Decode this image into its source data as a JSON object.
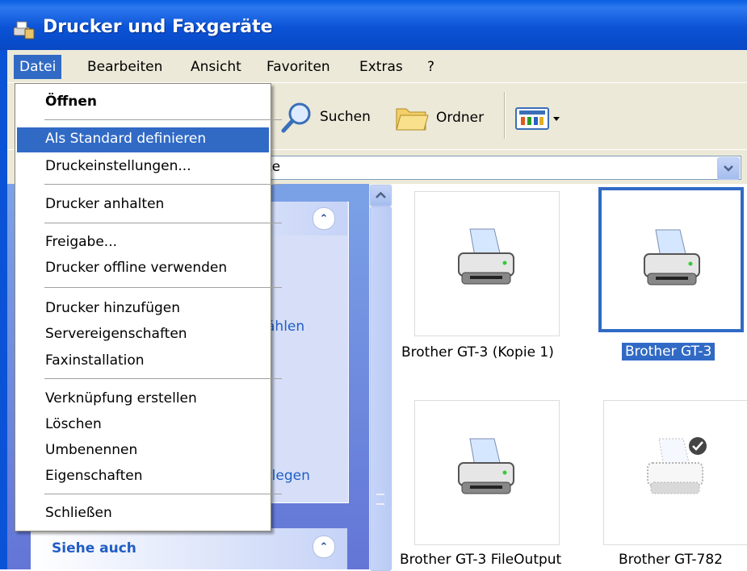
{
  "window": {
    "title": "Drucker und Faxgeräte"
  },
  "menubar": {
    "items": [
      "Datei",
      "Bearbeiten",
      "Ansicht",
      "Favoriten",
      "Extras",
      "?"
    ]
  },
  "toolbar": {
    "search_label": "Suchen",
    "folders_label": "Ordner"
  },
  "address": {
    "text_fragment": "te"
  },
  "dropdown": {
    "open": "Öffnen",
    "set_default": "Als Standard definieren",
    "print_prefs": "Druckeinstellungen...",
    "pause": "Drucker anhalten",
    "sharing": "Freigabe...",
    "offline": "Drucker offline verwenden",
    "add_printer": "Drucker hinzufügen",
    "server_props": "Servereigenschaften",
    "fax_setup": "Faxinstallation",
    "create_shortcut": "Verknüpfung erstellen",
    "delete": "Löschen",
    "rename": "Umbenennen",
    "properties": "Eigenschaften",
    "close": "Schließen"
  },
  "taskpane": {
    "partial_1": "ählen",
    "partial_2": "tlegen",
    "see_also": "Siehe auch"
  },
  "printers": [
    {
      "name": "Brother GT-3 (Kopie 1)"
    },
    {
      "name": "Brother GT-3",
      "selected": true
    },
    {
      "name": "Brother GT-3 FileOutput"
    },
    {
      "name": "Brother GT-782",
      "offline": true
    }
  ],
  "colors": {
    "titlebar": "#0b53d6",
    "selection": "#316ac5",
    "chrome": "#ece9d8"
  }
}
